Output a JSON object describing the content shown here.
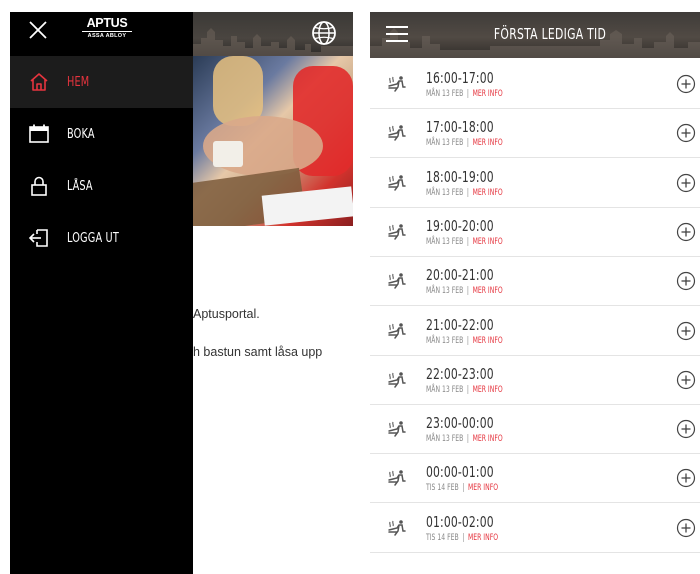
{
  "left": {
    "logo": {
      "main": "APTUS",
      "sub": "ASSA ABLOY"
    },
    "nav": [
      {
        "label": "HEM",
        "icon": "home-icon",
        "active": true
      },
      {
        "label": "BOKA",
        "icon": "calendar-icon",
        "active": false
      },
      {
        "label": "LÅSA",
        "icon": "lock-icon",
        "active": false
      },
      {
        "label": "LOGGA UT",
        "icon": "logout-icon",
        "active": false
      }
    ],
    "content": {
      "line1": "Aptusportal.",
      "line2": "h bastun samt låsa upp"
    },
    "globe_icon": "globe-icon"
  },
  "right": {
    "title": "FÖRSTA LEDIGA TID",
    "more_label": "MER INFO",
    "slots": [
      {
        "time": "16:00-17:00",
        "date": "MÅN 13 FEB"
      },
      {
        "time": "17:00-18:00",
        "date": "MÅN 13 FEB"
      },
      {
        "time": "18:00-19:00",
        "date": "MÅN 13 FEB"
      },
      {
        "time": "19:00-20:00",
        "date": "MÅN 13 FEB"
      },
      {
        "time": "20:00-21:00",
        "date": "MÅN 13 FEB"
      },
      {
        "time": "21:00-22:00",
        "date": "MÅN 13 FEB"
      },
      {
        "time": "22:00-23:00",
        "date": "MÅN 13 FEB"
      },
      {
        "time": "23:00-00:00",
        "date": "MÅN 13 FEB"
      },
      {
        "time": "00:00-01:00",
        "date": "TIS 14 FEB"
      },
      {
        "time": "01:00-02:00",
        "date": "TIS 14 FEB"
      }
    ]
  },
  "colors": {
    "accent": "#e5343e",
    "drawer": "#000000",
    "text": "#333333"
  }
}
